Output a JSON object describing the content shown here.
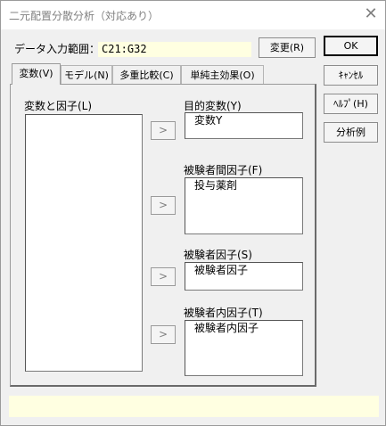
{
  "window": {
    "title": "二元配置分散分析（対応あり）",
    "close_glyph": "✕"
  },
  "range": {
    "label": "データ入力範囲：",
    "value": "C21:G32",
    "change_button": "変更(R)"
  },
  "side_buttons": {
    "ok": "OK",
    "cancel": "ｷｬﾝｾﾙ",
    "help": "ﾍﾙﾌﾟ(H)",
    "example": "分析例"
  },
  "tabs": [
    {
      "label": "変数(V)",
      "active": true
    },
    {
      "label": "モデル(N)",
      "active": false
    },
    {
      "label": "多重比較(C)",
      "active": false
    },
    {
      "label": "単純主効果(O)",
      "active": false
    }
  ],
  "panel": {
    "variables_label": "変数と因子(L)",
    "arrow_glyph": ">",
    "target_label": "目的変数(Y)",
    "target_value": "変数Y",
    "between_label": "被験者間因子(F)",
    "between_value": "投与薬剤",
    "subject_label": "被験者因子(S)",
    "subject_value": "被験者因子",
    "within_label": "被験者内因子(T)",
    "within_value": "被験者内因子"
  },
  "colors": {
    "window_bg": "#f0f0f0",
    "info_bg": "#ffffe1",
    "title_text": "#808080"
  }
}
